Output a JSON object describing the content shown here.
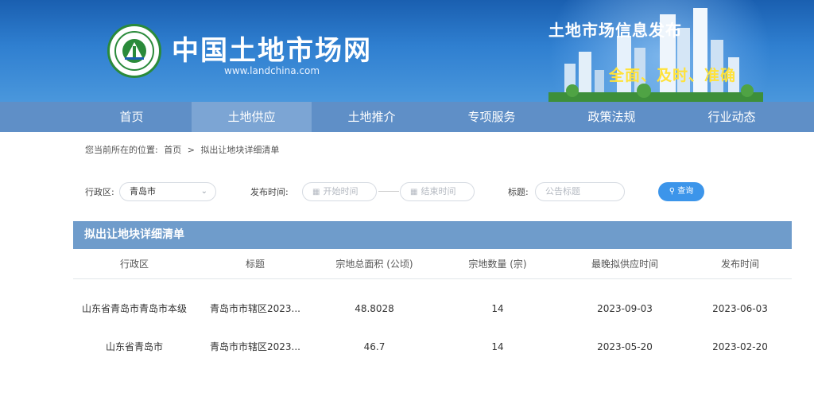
{
  "header": {
    "site_title": "中国土地市场网",
    "site_url": "www.landchina.com",
    "banner_title": "土地市场信息发布",
    "banner_slogan": "全面、及时、准确",
    "colors": {
      "banner": "#2f7fd0",
      "slogan": "#ffe23a"
    }
  },
  "nav": {
    "items": [
      {
        "label": "首页"
      },
      {
        "label": "土地供应"
      },
      {
        "label": "土地推介"
      },
      {
        "label": "专项服务"
      },
      {
        "label": "政策法规"
      },
      {
        "label": "行业动态"
      }
    ],
    "active_index": 1,
    "colors": {
      "bar": "#5f8fc7",
      "active": "#7ca5d4"
    }
  },
  "breadcrumb": {
    "prefix": "您当前所在的位置:",
    "home": "首页",
    "separator": ">",
    "current": "拟出让地块详细清单"
  },
  "filters": {
    "region_label": "行政区:",
    "region_value": "青岛市",
    "date_label": "发布时间:",
    "start_placeholder": "开始时间",
    "end_placeholder": "结束时间",
    "title_label": "标题:",
    "title_placeholder": "公告标题",
    "search_label": "查询",
    "search_color": "#3c95ea"
  },
  "table": {
    "heading": "拟出让地块详细清单",
    "columns": [
      "行政区",
      "标题",
      "宗地总面积 (公顷)",
      "宗地数量 (宗)",
      "最晚拟供应时间",
      "发布时间"
    ],
    "rows": [
      [
        "山东省青岛市青岛市本级",
        "青岛市市辖区2023...",
        "48.8028",
        "14",
        "2023-09-03",
        "2023-06-03"
      ],
      [
        "山东省青岛市",
        "青岛市市辖区2023...",
        "46.7",
        "14",
        "2023-05-20",
        "2023-02-20"
      ]
    ],
    "head_color": "#6f9ccb"
  }
}
